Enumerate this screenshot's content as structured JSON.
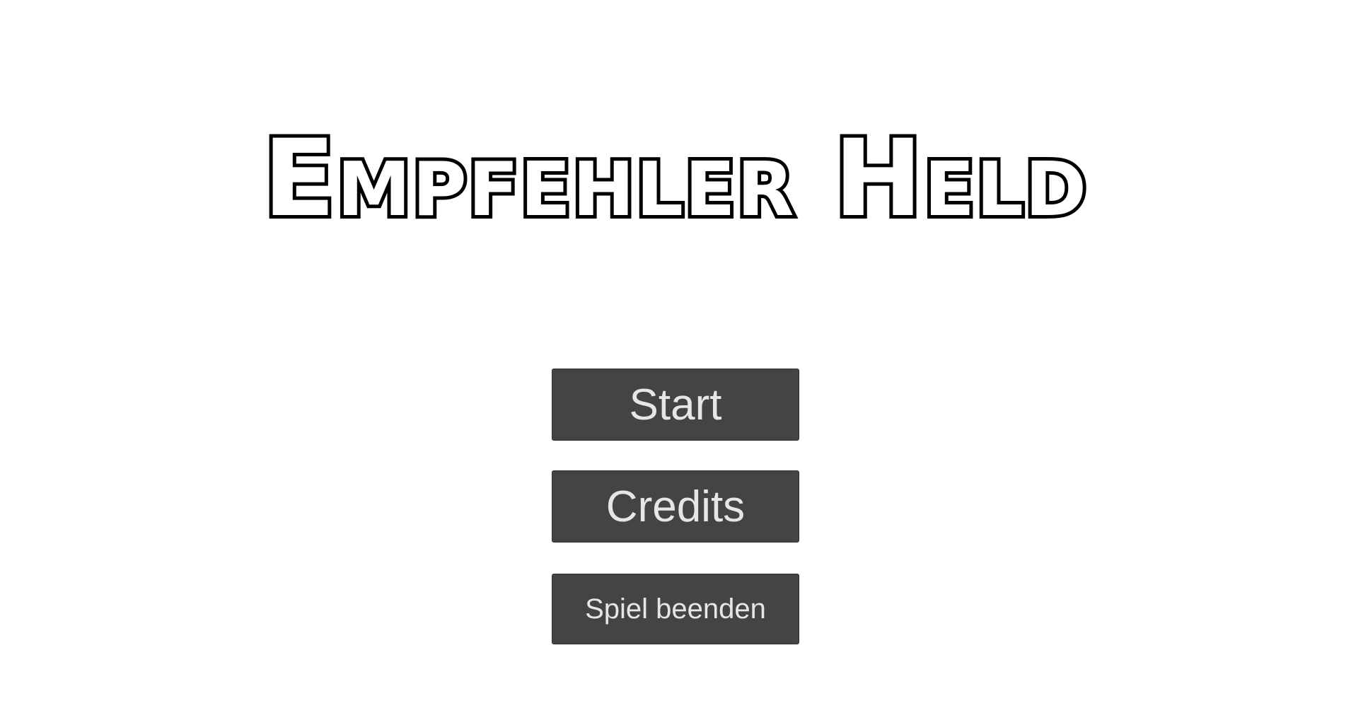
{
  "title": "Empfehler Held",
  "menu": {
    "start_label": "Start",
    "credits_label": "Credits",
    "quit_label": "Spiel beenden"
  },
  "colors": {
    "background": "#ffffff",
    "button_bg": "#444444",
    "button_text": "#e6e6e6",
    "title_fill": "#ffffff",
    "title_outline": "#000000"
  }
}
